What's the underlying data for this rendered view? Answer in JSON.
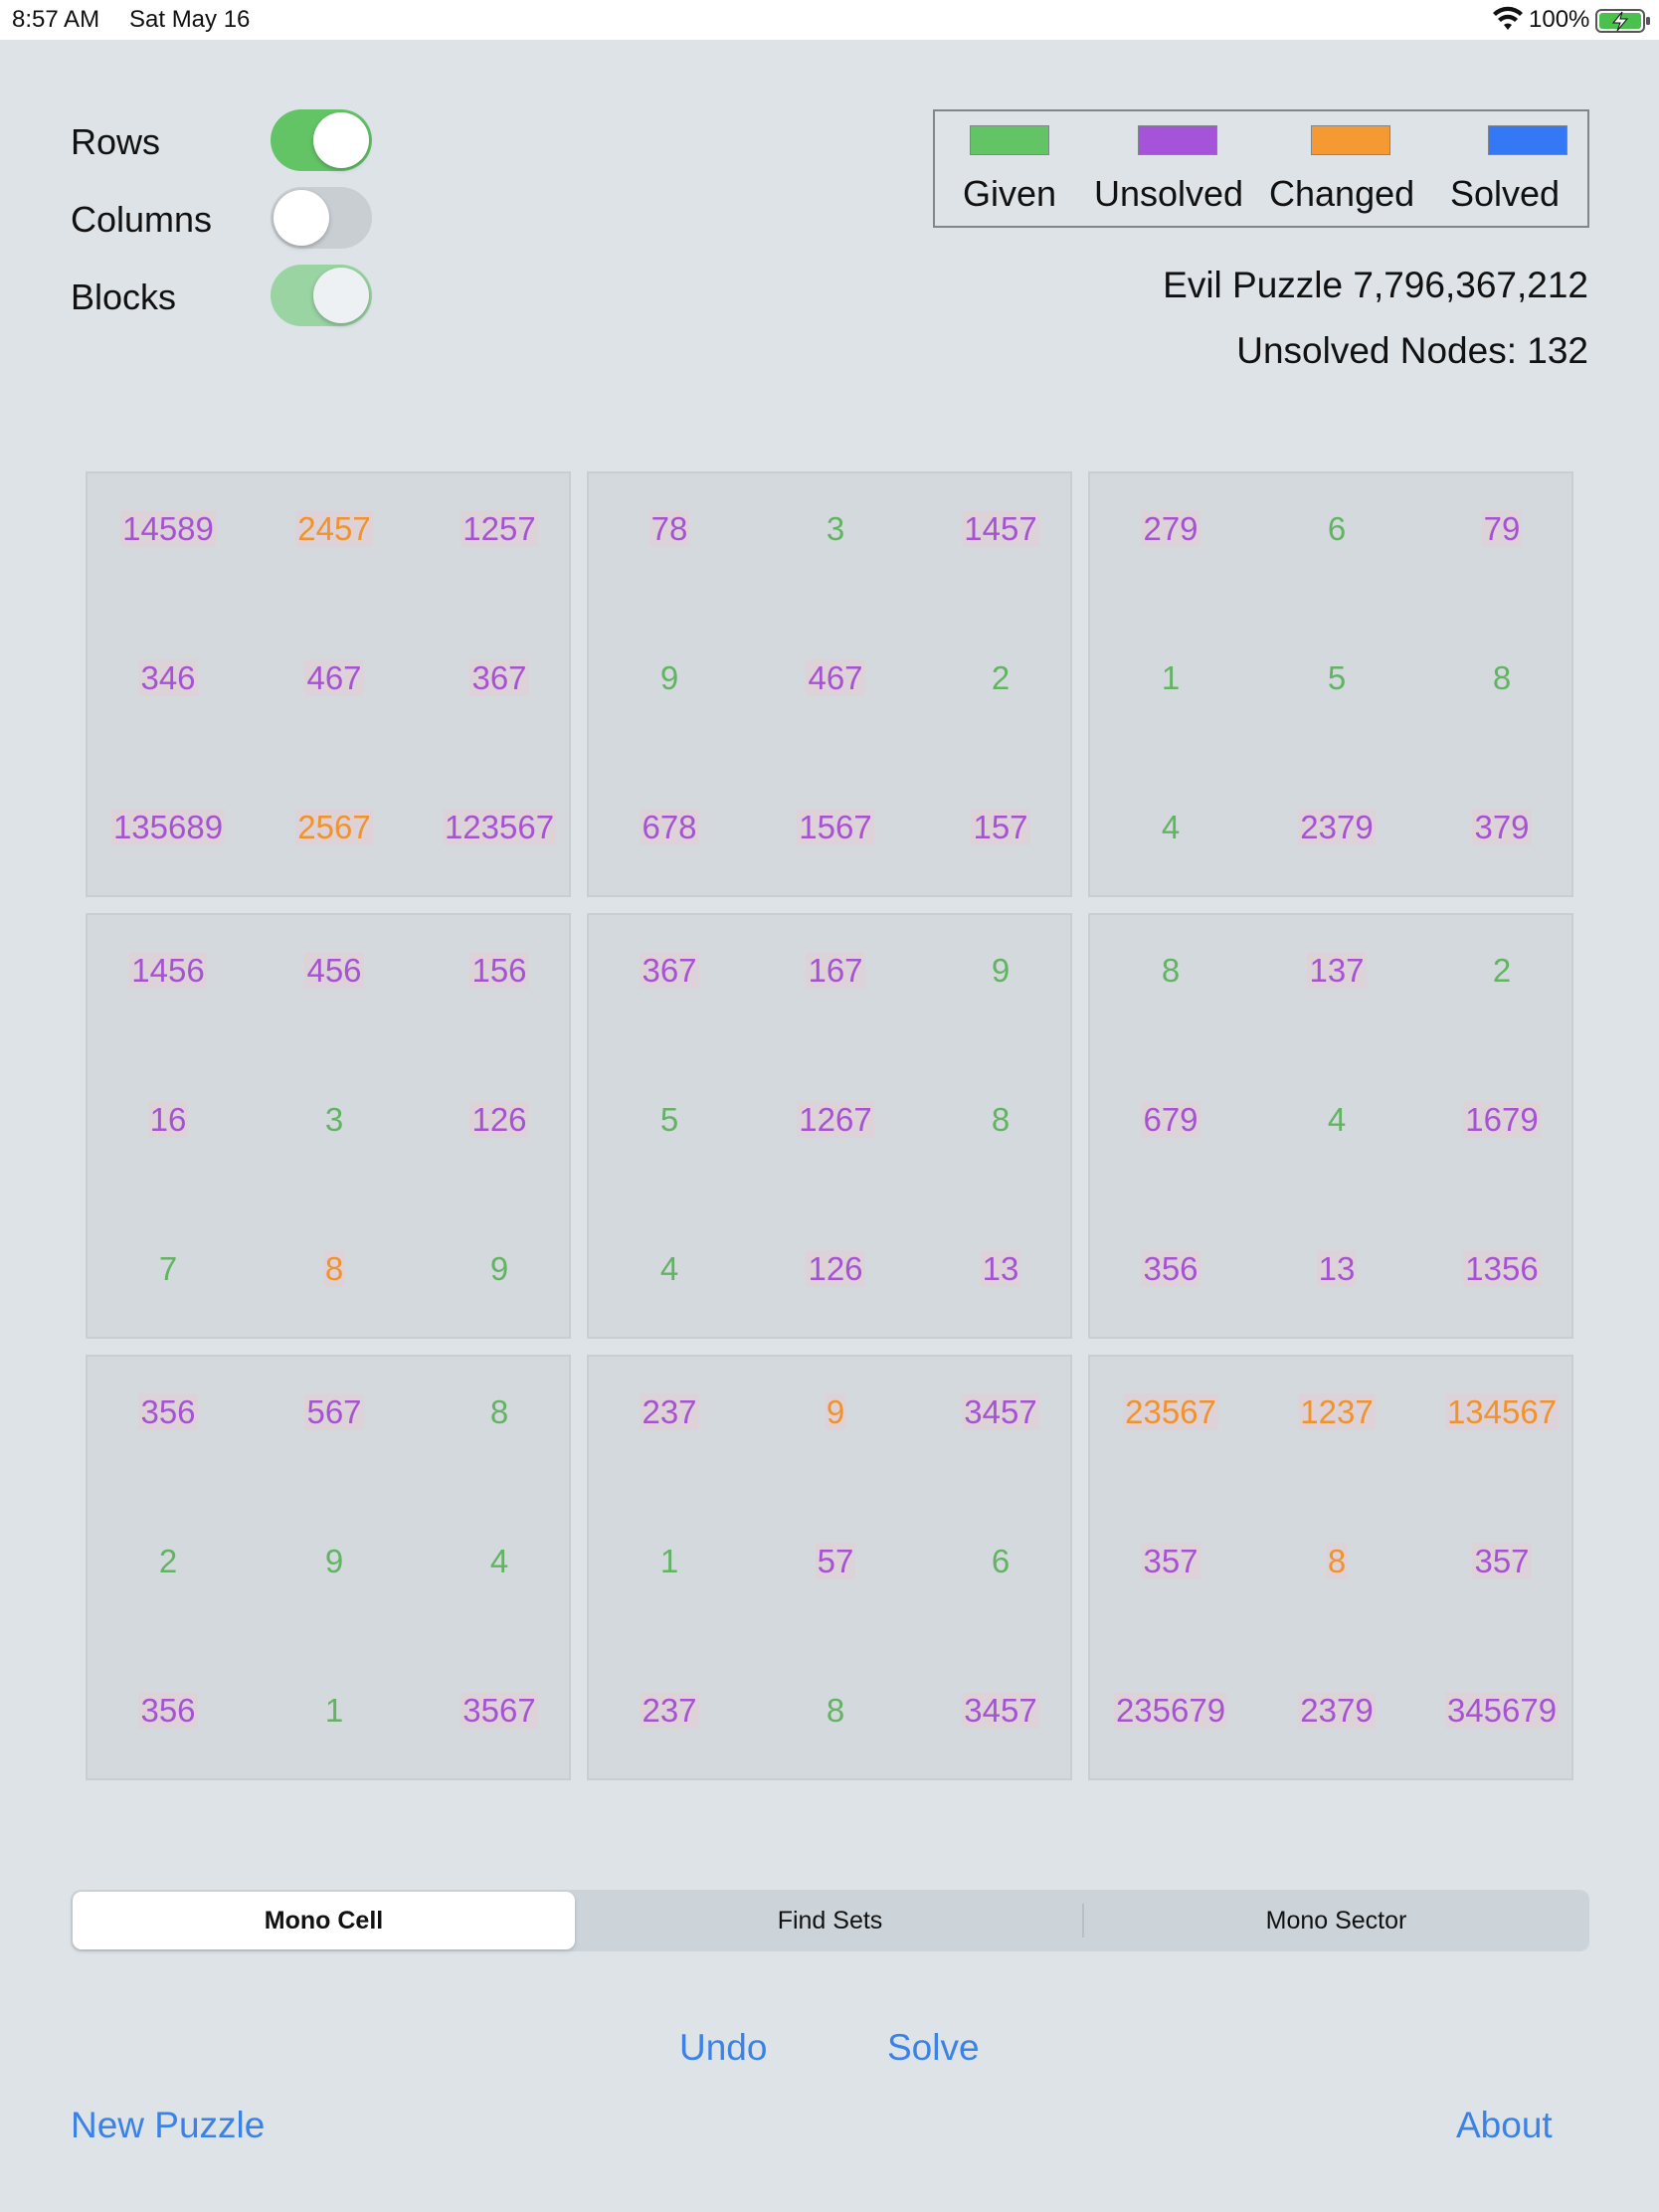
{
  "status_bar": {
    "time": "8:57 AM",
    "date": "Sat May 16",
    "battery": "100%"
  },
  "toggles": [
    {
      "label": "Rows",
      "on": true
    },
    {
      "label": "Columns",
      "on": false
    },
    {
      "label": "Blocks",
      "on": true
    }
  ],
  "legend": {
    "given": {
      "label": "Given",
      "color": "#62c465"
    },
    "unsolved": {
      "label": "Unsolved",
      "color": "#a553d8"
    },
    "changed": {
      "label": "Changed",
      "color": "#f59a33"
    },
    "solved": {
      "label": "Solved",
      "color": "#3478f6"
    }
  },
  "puzzle": {
    "title": "Evil Puzzle 7,796,367,212",
    "unsolved_nodes": "Unsolved Nodes: 132"
  },
  "colors": {
    "given": "#62b463",
    "unsolved": "#a653d3",
    "changed": "#f2922b"
  },
  "grid": [
    [
      {
        "v": "14589",
        "s": "unsolved"
      },
      {
        "v": "2457",
        "s": "changed"
      },
      {
        "v": "1257",
        "s": "unsolved"
      },
      {
        "v": "78",
        "s": "unsolved"
      },
      {
        "v": "3",
        "s": "given"
      },
      {
        "v": "1457",
        "s": "unsolved"
      },
      {
        "v": "279",
        "s": "unsolved"
      },
      {
        "v": "6",
        "s": "given"
      },
      {
        "v": "79",
        "s": "unsolved"
      }
    ],
    [
      {
        "v": "346",
        "s": "unsolved"
      },
      {
        "v": "467",
        "s": "unsolved"
      },
      {
        "v": "367",
        "s": "unsolved"
      },
      {
        "v": "9",
        "s": "given"
      },
      {
        "v": "467",
        "s": "unsolved"
      },
      {
        "v": "2",
        "s": "given"
      },
      {
        "v": "1",
        "s": "given"
      },
      {
        "v": "5",
        "s": "given"
      },
      {
        "v": "8",
        "s": "given"
      }
    ],
    [
      {
        "v": "135689",
        "s": "unsolved"
      },
      {
        "v": "2567",
        "s": "changed"
      },
      {
        "v": "123567",
        "s": "unsolved"
      },
      {
        "v": "678",
        "s": "unsolved"
      },
      {
        "v": "1567",
        "s": "unsolved"
      },
      {
        "v": "157",
        "s": "unsolved"
      },
      {
        "v": "4",
        "s": "given"
      },
      {
        "v": "2379",
        "s": "unsolved"
      },
      {
        "v": "379",
        "s": "unsolved"
      }
    ],
    [
      {
        "v": "1456",
        "s": "unsolved"
      },
      {
        "v": "456",
        "s": "unsolved"
      },
      {
        "v": "156",
        "s": "unsolved"
      },
      {
        "v": "367",
        "s": "unsolved"
      },
      {
        "v": "167",
        "s": "unsolved"
      },
      {
        "v": "9",
        "s": "given"
      },
      {
        "v": "8",
        "s": "given"
      },
      {
        "v": "137",
        "s": "unsolved"
      },
      {
        "v": "2",
        "s": "given"
      }
    ],
    [
      {
        "v": "16",
        "s": "unsolved"
      },
      {
        "v": "3",
        "s": "given"
      },
      {
        "v": "126",
        "s": "unsolved"
      },
      {
        "v": "5",
        "s": "given"
      },
      {
        "v": "1267",
        "s": "unsolved"
      },
      {
        "v": "8",
        "s": "given"
      },
      {
        "v": "679",
        "s": "unsolved"
      },
      {
        "v": "4",
        "s": "given"
      },
      {
        "v": "1679",
        "s": "unsolved"
      }
    ],
    [
      {
        "v": "7",
        "s": "given"
      },
      {
        "v": "8",
        "s": "changed"
      },
      {
        "v": "9",
        "s": "given"
      },
      {
        "v": "4",
        "s": "given"
      },
      {
        "v": "126",
        "s": "unsolved"
      },
      {
        "v": "13",
        "s": "unsolved"
      },
      {
        "v": "356",
        "s": "unsolved"
      },
      {
        "v": "13",
        "s": "unsolved"
      },
      {
        "v": "1356",
        "s": "unsolved"
      }
    ],
    [
      {
        "v": "356",
        "s": "unsolved"
      },
      {
        "v": "567",
        "s": "unsolved"
      },
      {
        "v": "8",
        "s": "given"
      },
      {
        "v": "237",
        "s": "unsolved"
      },
      {
        "v": "9",
        "s": "changed"
      },
      {
        "v": "3457",
        "s": "unsolved"
      },
      {
        "v": "23567",
        "s": "changed"
      },
      {
        "v": "1237",
        "s": "changed"
      },
      {
        "v": "134567",
        "s": "changed"
      }
    ],
    [
      {
        "v": "2",
        "s": "given"
      },
      {
        "v": "9",
        "s": "given"
      },
      {
        "v": "4",
        "s": "given"
      },
      {
        "v": "1",
        "s": "given"
      },
      {
        "v": "57",
        "s": "unsolved"
      },
      {
        "v": "6",
        "s": "given"
      },
      {
        "v": "357",
        "s": "unsolved"
      },
      {
        "v": "8",
        "s": "changed"
      },
      {
        "v": "357",
        "s": "unsolved"
      }
    ],
    [
      {
        "v": "356",
        "s": "unsolved"
      },
      {
        "v": "1",
        "s": "given"
      },
      {
        "v": "3567",
        "s": "unsolved"
      },
      {
        "v": "237",
        "s": "unsolved"
      },
      {
        "v": "8",
        "s": "given"
      },
      {
        "v": "3457",
        "s": "unsolved"
      },
      {
        "v": "235679",
        "s": "unsolved"
      },
      {
        "v": "2379",
        "s": "unsolved"
      },
      {
        "v": "345679",
        "s": "unsolved"
      }
    ]
  ],
  "segments": [
    "Mono Cell",
    "Find Sets",
    "Mono Sector"
  ],
  "selected_segment": 0,
  "buttons": {
    "undo": "Undo",
    "solve": "Solve",
    "new_puzzle": "New Puzzle",
    "about": "About"
  }
}
